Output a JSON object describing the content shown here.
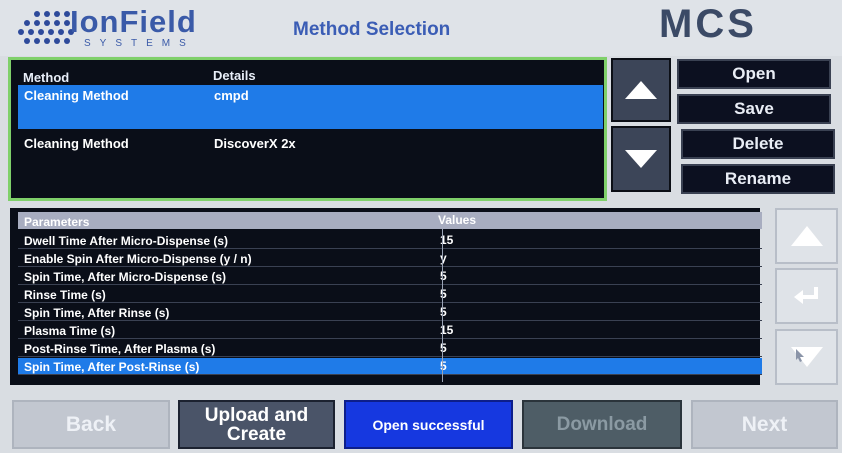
{
  "header": {
    "logo_text": "IonField",
    "logo_sub": "SYSTEMS",
    "title": "Method Selection",
    "brand": "MCS"
  },
  "methods": {
    "col_method": "Method",
    "col_details": "Details",
    "rows": [
      {
        "name": "Cleaning Method",
        "details": "cmpd",
        "selected": true
      },
      {
        "name": "Cleaning Method",
        "details": "DiscoverX 2x",
        "selected": false
      }
    ]
  },
  "method_actions": {
    "open": "Open",
    "save": "Save",
    "delete": "Delete",
    "rename": "Rename"
  },
  "parameters": {
    "col_param": "Parameters",
    "col_value": "Values",
    "rows": [
      {
        "name": "Dwell Time After Micro-Dispense (s)",
        "value": "15"
      },
      {
        "name": "Enable Spin After Micro-Dispense (y / n)",
        "value": "y"
      },
      {
        "name": "Spin Time, After Micro-Dispense (s)",
        "value": "5"
      },
      {
        "name": "Rinse Time (s)",
        "value": "5"
      },
      {
        "name": "Spin Time, After Rinse (s)",
        "value": "5"
      },
      {
        "name": "Plasma Time (s)",
        "value": "15"
      },
      {
        "name": "Post-Rinse Time,  After Plasma (s)",
        "value": "5"
      },
      {
        "name": "Spin Time, After Post-Rinse (s)",
        "value": "5"
      }
    ]
  },
  "footer": {
    "back": "Back",
    "upload_line1": "Upload and",
    "upload_line2": "Create",
    "status": "Open successful",
    "download": "Download",
    "next": "Next"
  },
  "icons": {
    "up": "up-arrow-icon",
    "down": "down-arrow-icon",
    "enter": "enter-icon",
    "down_cursor": "down-arrow-cursor-icon"
  },
  "colors": {
    "selection": "#1f7be8",
    "panel_border": "#7fd06a",
    "status_blue": "#1638e0"
  }
}
